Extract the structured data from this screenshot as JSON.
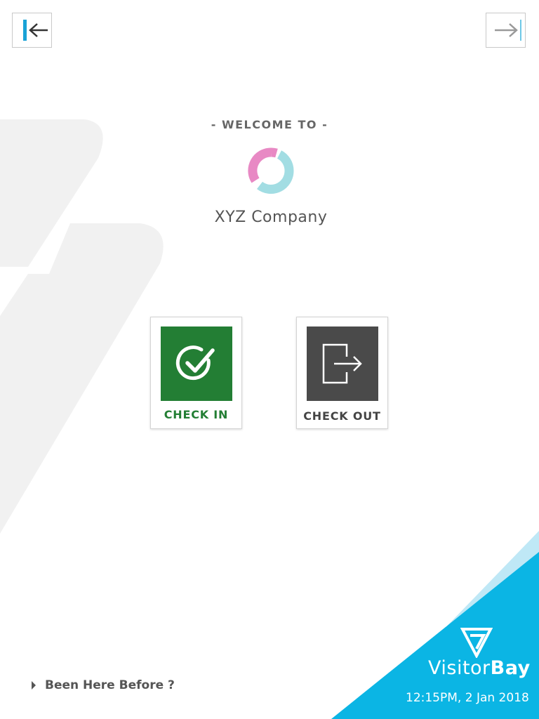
{
  "nav": {
    "back_icon": "arrow-left-bar-icon",
    "forward_icon": "arrow-right-bar-icon"
  },
  "welcome": {
    "heading": "- WELCOME TO -",
    "company_name": "XYZ Company",
    "logo_icon": "ring-logo-icon"
  },
  "actions": {
    "check_in": {
      "label": "CHECK IN",
      "icon": "check-circle-icon",
      "color": "#237e34"
    },
    "check_out": {
      "label": "CHECK OUT",
      "icon": "exit-door-icon",
      "color": "#4a4a4a"
    }
  },
  "footer": {
    "been_here_label": "Been Here Before ?",
    "brand_light": "Visitor",
    "brand_bold": "Bay",
    "datetime": "12:15PM, 2 Jan 2018",
    "accent_color": "#0bb5e4"
  }
}
